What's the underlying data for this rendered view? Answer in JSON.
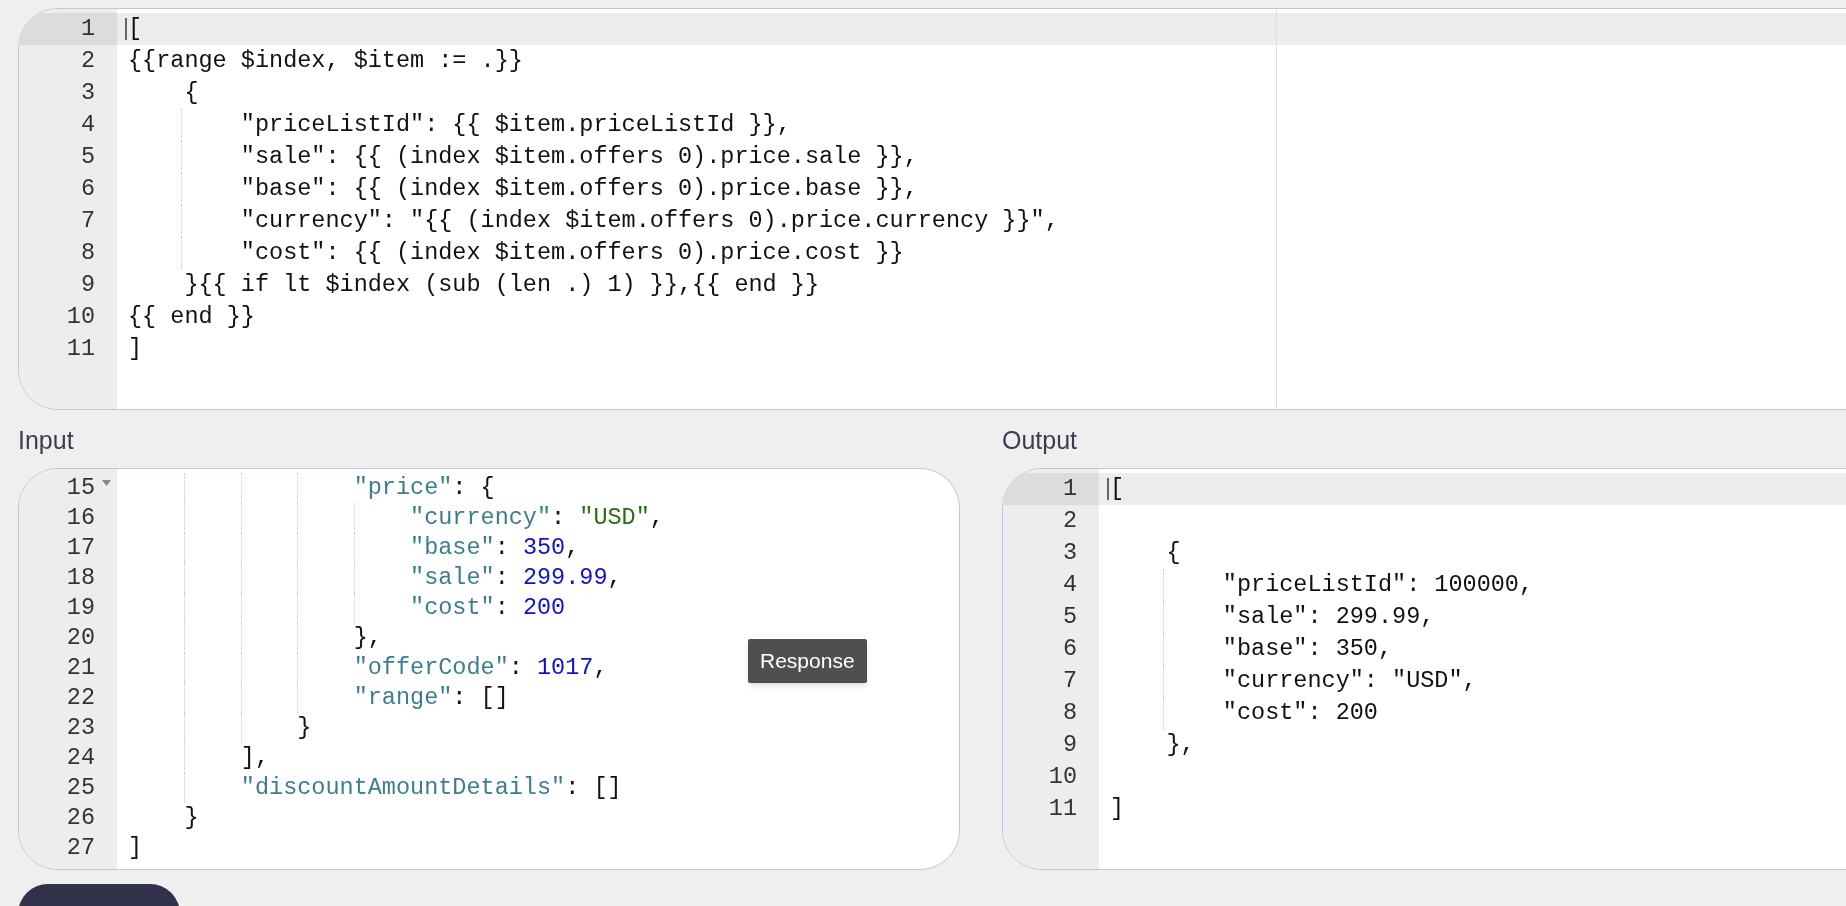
{
  "template_editor": {
    "lines": [
      {
        "number": "1",
        "text": "[",
        "active": true
      },
      {
        "number": "2",
        "text": "{{range $index, $item := .}}",
        "active": false
      },
      {
        "number": "3",
        "text": "    {",
        "active": false
      },
      {
        "number": "4",
        "text": "        \"priceListId\": {{ $item.priceListId }},",
        "active": false
      },
      {
        "number": "5",
        "text": "        \"sale\": {{ (index $item.offers 0).price.sale }},",
        "active": false
      },
      {
        "number": "6",
        "text": "        \"base\": {{ (index $item.offers 0).price.base }},",
        "active": false
      },
      {
        "number": "7",
        "text": "        \"currency\": \"{{ (index $item.offers 0).price.currency }}\",",
        "active": false
      },
      {
        "number": "8",
        "text": "        \"cost\": {{ (index $item.offers 0).price.cost }}",
        "active": false
      },
      {
        "number": "9",
        "text": "    }{{ if lt $index (sub (len .) 1) }},{{ end }}",
        "active": false
      },
      {
        "number": "10",
        "text": "{{ end }}",
        "active": false
      },
      {
        "number": "11",
        "text": "]",
        "active": false
      }
    ]
  },
  "input": {
    "label": "Input",
    "lines": [
      {
        "number": "15",
        "fold": true,
        "tokens": [
          {
            "kind": "key",
            "text": "                \"price\""
          },
          {
            "kind": "punct",
            "text": ": {"
          }
        ]
      },
      {
        "number": "16",
        "fold": false,
        "tokens": [
          {
            "kind": "key",
            "text": "                    \"currency\""
          },
          {
            "kind": "punct",
            "text": ": "
          },
          {
            "kind": "string",
            "text": "\"USD\""
          },
          {
            "kind": "punct",
            "text": ","
          }
        ]
      },
      {
        "number": "17",
        "fold": false,
        "tokens": [
          {
            "kind": "key",
            "text": "                    \"base\""
          },
          {
            "kind": "punct",
            "text": ": "
          },
          {
            "kind": "number",
            "text": "350"
          },
          {
            "kind": "punct",
            "text": ","
          }
        ]
      },
      {
        "number": "18",
        "fold": false,
        "tokens": [
          {
            "kind": "key",
            "text": "                    \"sale\""
          },
          {
            "kind": "punct",
            "text": ": "
          },
          {
            "kind": "number",
            "text": "299.99"
          },
          {
            "kind": "punct",
            "text": ","
          }
        ]
      },
      {
        "number": "19",
        "fold": false,
        "tokens": [
          {
            "kind": "key",
            "text": "                    \"cost\""
          },
          {
            "kind": "punct",
            "text": ": "
          },
          {
            "kind": "number",
            "text": "200"
          }
        ]
      },
      {
        "number": "20",
        "fold": false,
        "tokens": [
          {
            "kind": "punct",
            "text": "                },"
          }
        ]
      },
      {
        "number": "21",
        "fold": false,
        "tokens": [
          {
            "kind": "key",
            "text": "                \"offerCode\""
          },
          {
            "kind": "punct",
            "text": ": "
          },
          {
            "kind": "number",
            "text": "1017"
          },
          {
            "kind": "punct",
            "text": ","
          }
        ]
      },
      {
        "number": "22",
        "fold": false,
        "tokens": [
          {
            "kind": "key",
            "text": "                \"range\""
          },
          {
            "kind": "punct",
            "text": ": []"
          }
        ]
      },
      {
        "number": "23",
        "fold": false,
        "tokens": [
          {
            "kind": "punct",
            "text": "            }"
          }
        ]
      },
      {
        "number": "24",
        "fold": false,
        "tokens": [
          {
            "kind": "punct",
            "text": "        ],"
          }
        ]
      },
      {
        "number": "25",
        "fold": false,
        "tokens": [
          {
            "kind": "key",
            "text": "        \"discountAmountDetails\""
          },
          {
            "kind": "punct",
            "text": ": []"
          }
        ]
      },
      {
        "number": "26",
        "fold": false,
        "tokens": [
          {
            "kind": "punct",
            "text": "    }"
          }
        ]
      },
      {
        "number": "27",
        "fold": false,
        "tokens": [
          {
            "kind": "punct",
            "text": "]"
          }
        ]
      }
    ]
  },
  "tooltip": {
    "text": "Response"
  },
  "output": {
    "label": "Output",
    "lines": [
      {
        "number": "1",
        "text": "[",
        "active": true
      },
      {
        "number": "2",
        "active": false
      },
      {
        "number": "3",
        "text": "    {",
        "active": false
      },
      {
        "number": "4",
        "text": "        \"priceListId\": 100000,",
        "active": false
      },
      {
        "number": "5",
        "text": "        \"sale\": 299.99,",
        "active": false
      },
      {
        "number": "6",
        "text": "        \"base\": 350,",
        "active": false
      },
      {
        "number": "7",
        "text": "        \"currency\": \"USD\",",
        "active": false
      },
      {
        "number": "8",
        "text": "        \"cost\": 200",
        "active": false
      },
      {
        "number": "9",
        "text": "    },",
        "active": false
      },
      {
        "number": "10",
        "active": false
      },
      {
        "number": "11",
        "text": "]",
        "active": false
      }
    ]
  }
}
